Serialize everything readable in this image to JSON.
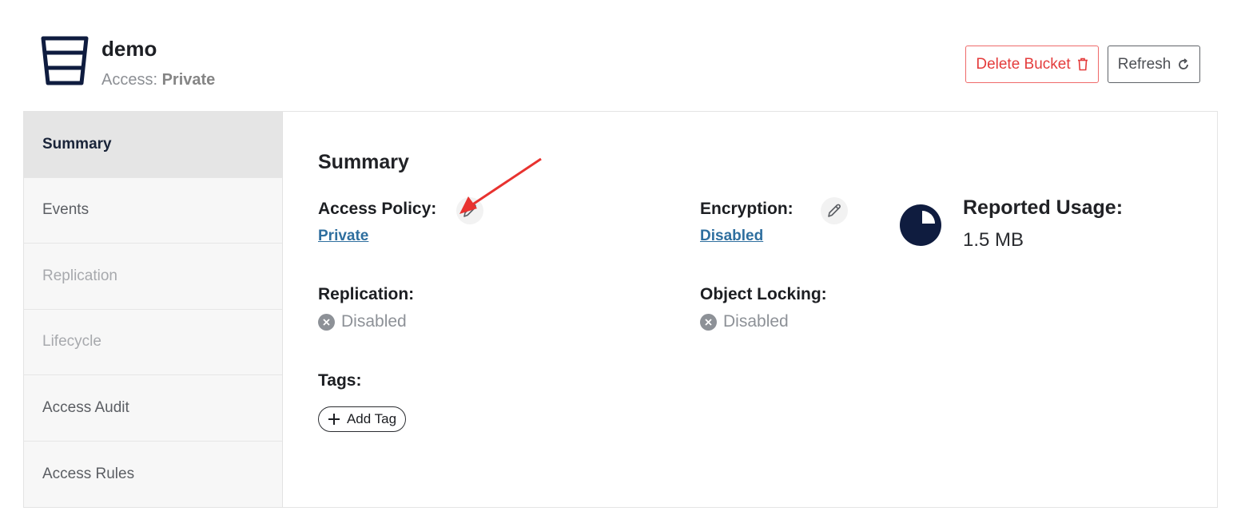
{
  "header": {
    "bucket_name": "demo",
    "access_label": "Access:",
    "access_value": "Private",
    "delete_label": "Delete Bucket",
    "refresh_label": "Refresh"
  },
  "sidebar": {
    "items": [
      {
        "label": "Summary",
        "state": "active"
      },
      {
        "label": "Events",
        "state": "normal"
      },
      {
        "label": "Replication",
        "state": "disabled"
      },
      {
        "label": "Lifecycle",
        "state": "disabled"
      },
      {
        "label": "Access Audit",
        "state": "normal"
      },
      {
        "label": "Access Rules",
        "state": "normal"
      }
    ]
  },
  "summary": {
    "title": "Summary",
    "access_policy_label": "Access Policy:",
    "access_policy_value": "Private",
    "encryption_label": "Encryption:",
    "encryption_value": "Disabled",
    "replication_label": "Replication:",
    "replication_value": "Disabled",
    "object_locking_label": "Object Locking:",
    "object_locking_value": "Disabled",
    "tags_label": "Tags:",
    "add_tag_label": "Add Tag",
    "reported_usage_label": "Reported Usage:",
    "reported_usage_value": "1.5 MB"
  },
  "colors": {
    "accent_navy": "#0f1c3f",
    "link_blue": "#2f6f9f",
    "danger_red": "#e43c3c",
    "annotation_arrow": "#e8322f"
  },
  "icons": [
    "bucket-icon",
    "trash-icon",
    "refresh-icon",
    "pencil-icon",
    "x-circle-icon",
    "pie-chart-icon",
    "plus-icon",
    "annotation-arrow"
  ]
}
